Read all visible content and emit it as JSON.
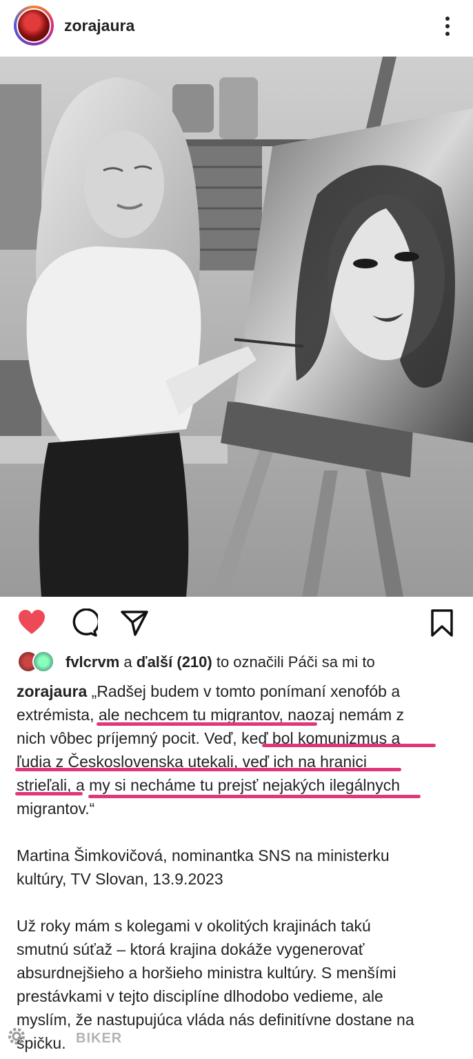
{
  "header": {
    "username": "zorajaura",
    "icons": {
      "avatar": "profile-avatar",
      "more": "more-vertical-icon"
    }
  },
  "post_image": {
    "description_icon": "painting-photo"
  },
  "actions": {
    "icons": [
      "heart-icon",
      "comment-icon",
      "share-icon",
      "bookmark-icon"
    ],
    "heart_color": "#ed4956"
  },
  "likes": {
    "user": "fvlcrvm",
    "conj": " a ",
    "others": "ďalší (210)",
    "suffix": " to označili Páči sa mi to"
  },
  "caption": {
    "username": "zorajaura",
    "lines": [
      " „Radšej budem v tomto ponímaní xenofób a",
      "extrémista, ale nechcem tu migrantov, naozaj nemám z",
      "nich vôbec príjemný pocit. Veď, keď bol komunizmus a",
      "ľudia z Československa utekali, veď ich na hranici",
      "strieľali, a my si necháme tu prejsť nejakých ilegálnych",
      "migrantov.“"
    ],
    "attribution": [
      "Martina Šimkovičová, nominantka SNS na ministerku",
      "kultúry, TV Slovan, 13.9.2023"
    ],
    "commentary": [
      "Už roky mám s kolegami v okolitých krajinách takú",
      "smutnú súťaž – ktorá krajina dokáže vygenerovať",
      "absurdnejšieho a horšieho ministra kultúry. S menšími",
      "prestávkami v tejto disciplíne dlhodobo vedieme, ale",
      "myslím, že nastupujúca vláda nás definitívne dostane na",
      "špičku."
    ]
  },
  "highlight_color": "#e0377a",
  "watermark": "BIKER"
}
